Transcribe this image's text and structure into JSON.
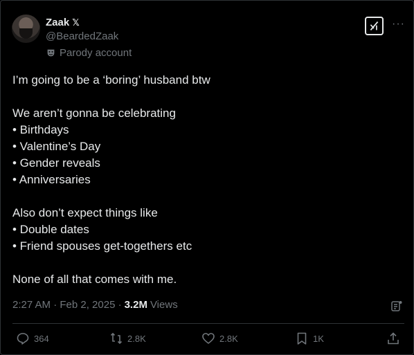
{
  "author": {
    "name": "Zaak",
    "verified_badge": "𝕏",
    "handle": "@BeardedZaak",
    "parody_label": "Parody account"
  },
  "tweet": {
    "lines": [
      "I’m going to be a ‘boring’ husband btw",
      "",
      "We aren’t gonna be celebrating",
      "• Birthdays",
      "• Valentine’s Day",
      "• Gender reveals",
      "• Anniversaries",
      "",
      "Also don’t expect things like",
      "• Double dates",
      "• Friend spouses get-togethers etc",
      "",
      "None of all that comes with me."
    ]
  },
  "meta": {
    "timestamp": "2:27 AM · Feb 2, 2025 ·",
    "views_count": "3.2M",
    "views_label": "Views"
  },
  "actions": {
    "replies": "364",
    "reposts": "2.8K",
    "likes": "2.8K",
    "bookmarks": "1K"
  },
  "icons": [
    "grok-icon",
    "more-icon",
    "parody-mask-icon",
    "analytics-icon",
    "reply-icon",
    "repost-icon",
    "like-icon",
    "bookmark-icon",
    "share-icon"
  ],
  "colors": {
    "background": "#000000",
    "text": "#e7e9ea",
    "secondary_text": "#71767b",
    "divider": "#2f3336"
  }
}
